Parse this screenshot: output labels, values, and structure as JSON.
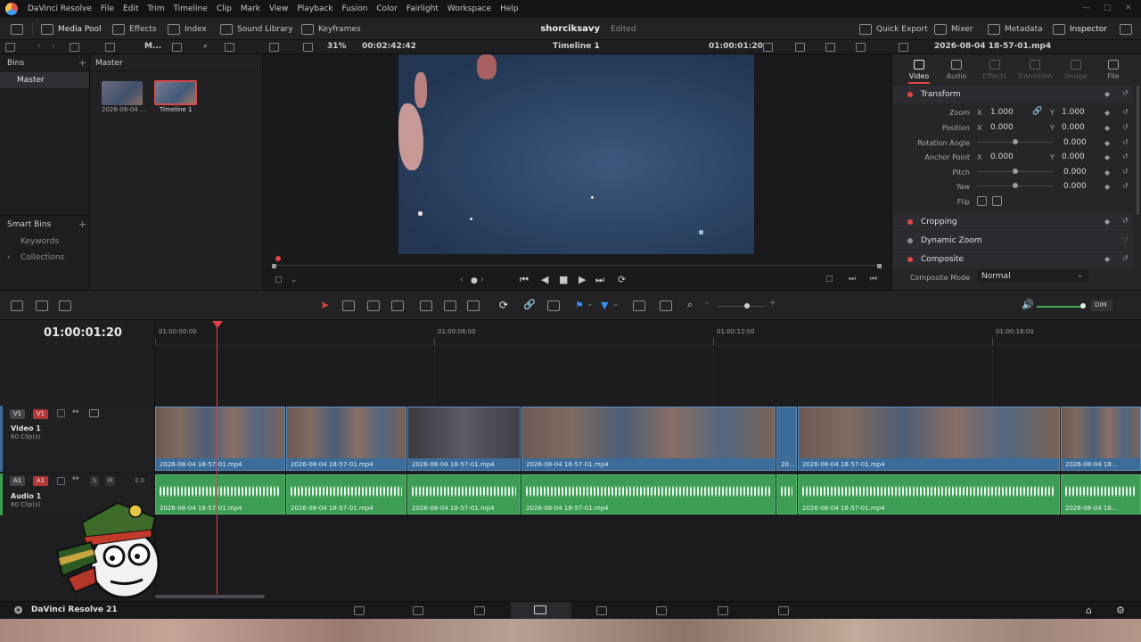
{
  "menubar": {
    "app_name": "DaVinci Resolve",
    "items": [
      "File",
      "Edit",
      "Trim",
      "Timeline",
      "Clip",
      "Mark",
      "View",
      "Playback",
      "Fusion",
      "Color",
      "Fairlight",
      "Workspace",
      "Help"
    ]
  },
  "toolbar": {
    "media_pool": "Media Pool",
    "effects": "Effects",
    "index": "Index",
    "sound_library": "Sound Library",
    "keyframes": "Keyframes",
    "project_name": "shorciksavy",
    "project_status": "Edited",
    "quick_export": "Quick Export",
    "mixer": "Mixer",
    "metadata": "Metadata",
    "inspector": "Inspector"
  },
  "subbar": {
    "panel_label": "M...",
    "zoom": "31%",
    "source_tc": "00:02:42:42",
    "timeline_name": "Timeline 1",
    "record_tc": "01:00:01:20",
    "clip_name": "2026-08-04 18-57-01.mp4"
  },
  "bins": {
    "title": "Bins",
    "master": "Master",
    "smart_bins_title": "Smart Bins",
    "smart_items": [
      "Keywords",
      "Collections"
    ]
  },
  "media_pool": {
    "header": "Master",
    "items": [
      {
        "label": "2026-08-04 ..."
      },
      {
        "label": "Timeline 1"
      }
    ]
  },
  "inspector": {
    "tabs": [
      "Video",
      "Audio",
      "Effects",
      "Transition",
      "Image",
      "File"
    ],
    "transform_title": "Transform",
    "zoom_label": "Zoom",
    "zoom_x": "1.000",
    "zoom_y": "1.000",
    "position_label": "Position",
    "position_x": "0.000",
    "position_y": "0.000",
    "rotation_label": "Rotation Angle",
    "rotation_val": "0.000",
    "anchor_label": "Anchor Point",
    "anchor_x": "0.000",
    "anchor_y": "0.000",
    "pitch_label": "Pitch",
    "pitch_val": "0.000",
    "yaw_label": "Yaw",
    "yaw_val": "0.000",
    "flip_label": "Flip",
    "axis_x": "X",
    "axis_y": "Y",
    "cropping_title": "Cropping",
    "dynamic_zoom_title": "Dynamic Zoom",
    "composite_title": "Composite",
    "composite_mode_label": "Composite Mode",
    "composite_mode_value": "Normal"
  },
  "timeline": {
    "current_tc": "01:00:01:20",
    "ruler": [
      "01:00:00:00",
      "01:00:06:00",
      "01:00:12:00",
      "01:00:18:00"
    ],
    "audio_dim": "DIM",
    "video_track": {
      "badge_a": "V1",
      "badge_b": "V1",
      "name": "Video 1",
      "count": "60 Clip(s)"
    },
    "audio_track": {
      "badge_a": "A1",
      "badge_b": "A1",
      "name": "Audio 1",
      "count": "60 Clip(s)",
      "s": "S",
      "m": "M",
      "level": "2.0"
    },
    "clip_name": "2026-08-04 18-57-01.mp4",
    "clip_short": "20...",
    "clip_tail": "2026-08-04 18..."
  },
  "pagebar": {
    "version_label": "DaVinci Resolve 21"
  },
  "colors": {
    "accent_red": "#e04848",
    "video_clip": "#3b6c9a",
    "audio_clip": "#3e9d55",
    "playhead": "#e0404a"
  }
}
